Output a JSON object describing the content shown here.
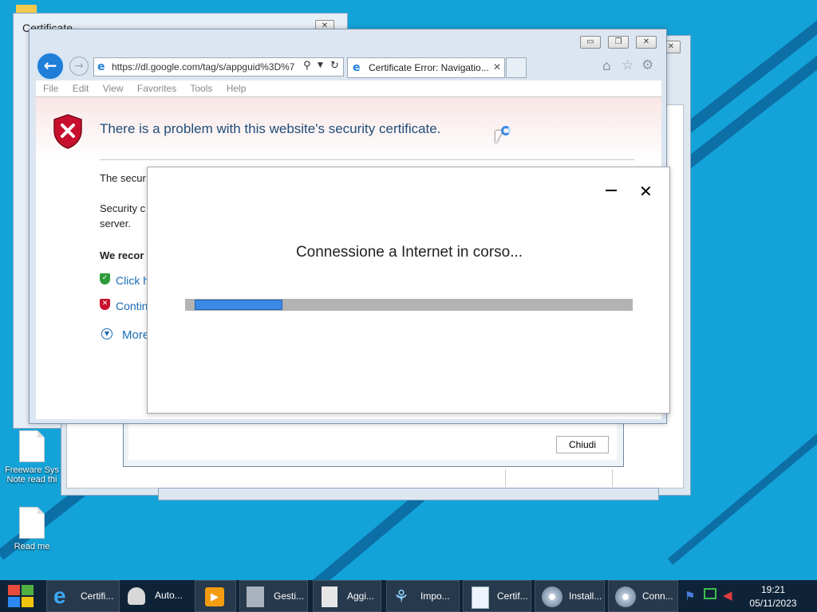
{
  "desktop": {
    "icons": [
      {
        "label_line1": "Freeware Sys",
        "label_line2": "Note read thi"
      },
      {
        "label_line1": "Read me"
      }
    ]
  },
  "cert_dialog_back": {
    "title": "Certificate",
    "close_label": "Chiudi"
  },
  "browser": {
    "address": "https://dl.google.com/tag/s/appguid%3D%7",
    "tab_title": "Certificate Error: Navigatio...",
    "menu": [
      "File",
      "Edit",
      "View",
      "Favorites",
      "Tools",
      "Help"
    ],
    "error_heading": "There is a problem with this website's security certificate.",
    "para1": "The secur",
    "para2_line1": "Security c",
    "para2_line2": "server.",
    "recommend": "We recor",
    "link1": "Click h",
    "link2": "Contin",
    "more": "More"
  },
  "connection_dialog": {
    "message": "Connessione a Internet in corso...",
    "progress_fraction": 0.2
  },
  "taskbar": {
    "items": [
      {
        "label": "Certifi..."
      },
      {
        "label": "Auto..."
      },
      {
        "label": ""
      },
      {
        "label": "Gesti..."
      },
      {
        "label": "Aggi..."
      },
      {
        "label": "Impo..."
      },
      {
        "label": "Certif..."
      },
      {
        "label": "Install..."
      },
      {
        "label": "Conn..."
      }
    ],
    "time": "19:21",
    "date": "05/11/2023"
  },
  "colors": {
    "desktop": "#14a3d9",
    "taskbar": "#0f2338",
    "progress": "#3b8ae6",
    "error_red": "#c8102e",
    "ie_blue": "#1f7fd8"
  }
}
